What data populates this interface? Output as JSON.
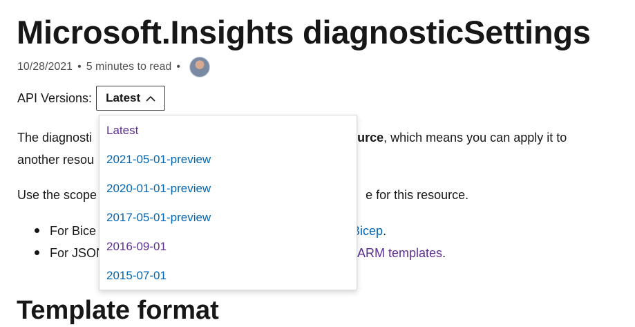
{
  "page": {
    "title": "Microsoft.Insights diagnosticSettings",
    "date": "10/28/2021",
    "sep": "•",
    "read_time": "5 minutes to read",
    "sep2": "•"
  },
  "api": {
    "label": "API Versions:",
    "selected": "Latest",
    "options": [
      "Latest",
      "2021-05-01-preview",
      "2020-01-01-preview",
      "2017-05-01-preview",
      "2016-09-01",
      "2015-07-01"
    ]
  },
  "body": {
    "p1_start": "The diagnosti",
    "p1_bold": "source",
    "p1_end": ", which means you can apply it to",
    "p1_line2": "another resou",
    "p2_start": "Use the scope",
    "p2_end": "e for this resource.",
    "bullet1_start": "For Bice",
    "bullet1_link": "Bicep",
    "bullet1_end": ".",
    "bullet2_start": "For JSON",
    "bullet2_link": "ARM templates",
    "bullet2_end": "."
  },
  "section": {
    "heading": "Template format"
  },
  "colors": {
    "link": "#0065b3",
    "visited": "#5c2e91",
    "text": "#171717"
  }
}
